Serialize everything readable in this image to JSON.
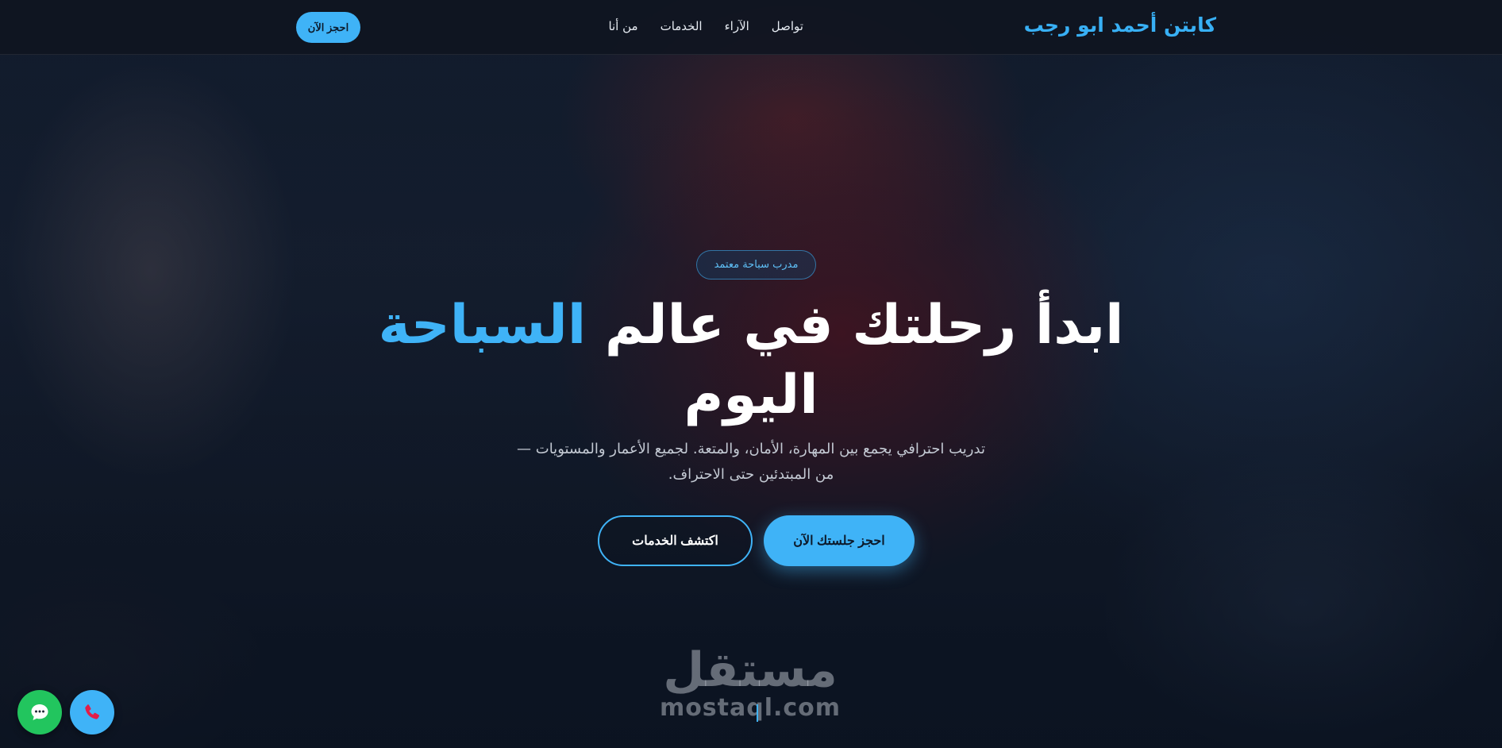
{
  "nav": {
    "brand": "كابتن أحمد ابو رجب",
    "links": [
      "من أنا",
      "الخدمات",
      "الآراء",
      "تواصل"
    ],
    "cta_label": "احجز الآن"
  },
  "hero": {
    "badge": "مدرب سباحة معتمد",
    "headline_part1": "ابدأ رحلتك في عالم ",
    "headline_accent": "السباحة",
    "headline_part2": "اليوم",
    "subtitle_line1": "تدريب احترافي يجمع بين المهارة، الأمان، والمتعة. لجميع الأعمار والمستويات —",
    "subtitle_line2": "من المبتدئين حتى الاحتراف.",
    "primary_button": "احجز جلستك الآن",
    "secondary_button": "اكتشف الخدمات"
  },
  "floating": {
    "whatsapp_icon": "chat-bubble-icon",
    "phone_icon": "phone-icon"
  },
  "watermark": {
    "arabic": "مستقل",
    "latin": "mostaql.com"
  },
  "colors": {
    "accent": "#3fb3f7",
    "whatsapp": "#22c55e",
    "navbar_bg": "#0f1420"
  }
}
